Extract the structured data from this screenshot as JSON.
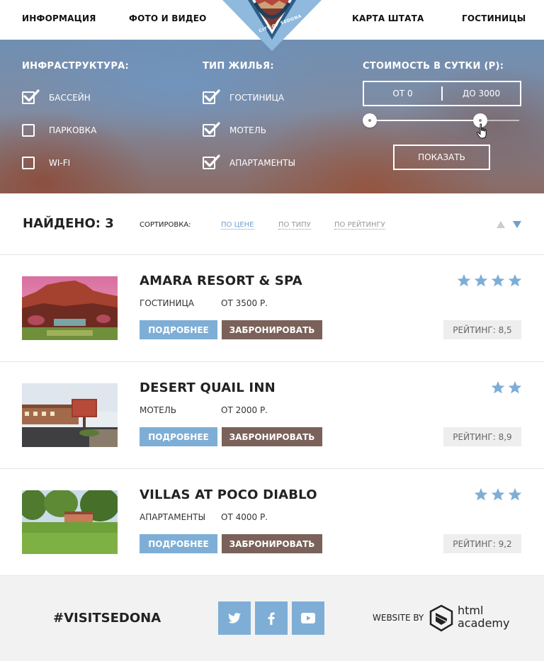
{
  "header": {
    "nav_left": [
      "Информация",
      "Фото и видео"
    ],
    "nav_right": [
      "Карта штата",
      "Гостиницы"
    ],
    "logo_text": "CITY OF SEDONA"
  },
  "filters": {
    "infrastructure": {
      "title": "Инфраструктура:",
      "options": [
        {
          "label": "Бассейн",
          "checked": true
        },
        {
          "label": "Парковка",
          "checked": false
        },
        {
          "label": "Wi-Fi",
          "checked": false
        }
      ]
    },
    "housing_type": {
      "title": "Тип жилья:",
      "options": [
        {
          "label": "Гостиница",
          "checked": true
        },
        {
          "label": "Мотель",
          "checked": true
        },
        {
          "label": "Апартаменты",
          "checked": true
        }
      ]
    },
    "price": {
      "title": "Стоимость в сутки (Р):",
      "from": "от 0",
      "to": "до 3000",
      "range_min_fraction": 0.0,
      "range_max_fraction": 0.74
    },
    "show_button": "Показать"
  },
  "results": {
    "found": "Найдено: 3",
    "sort_label": "Сортировка:",
    "sort_options": [
      {
        "label": "по цене",
        "active": true
      },
      {
        "label": "по типу",
        "active": false
      },
      {
        "label": "по рейтингу",
        "active": false
      }
    ]
  },
  "hotels": [
    {
      "name": "Amara Resort & Spa",
      "type": "Гостиница",
      "price": "от 3500 р.",
      "stars": 4,
      "rating": "Рейтинг: 8,5",
      "more": "Подробнее",
      "book": "Забронировать"
    },
    {
      "name": "Desert Quail Inn",
      "type": "Мотель",
      "price": "от 2000 р.",
      "stars": 2,
      "rating": "Рейтинг: 8,9",
      "more": "Подробнее",
      "book": "Забронировать"
    },
    {
      "name": "Villas at Poco Diablo",
      "type": "Апартаменты",
      "price": "от 4000 р.",
      "stars": 3,
      "rating": "Рейтинг: 9,2",
      "more": "Подробнее",
      "book": "Забронировать"
    }
  ],
  "footer": {
    "hashtag": "#visitsedona",
    "social": [
      "twitter-icon",
      "facebook-icon",
      "youtube-icon"
    ],
    "website_by": "Website by",
    "academy_line1": "html",
    "academy_line2": "academy"
  },
  "colors": {
    "accent_blue": "#7eaed6",
    "book_brown": "#7a6159",
    "star_blue": "#7eaed6"
  }
}
